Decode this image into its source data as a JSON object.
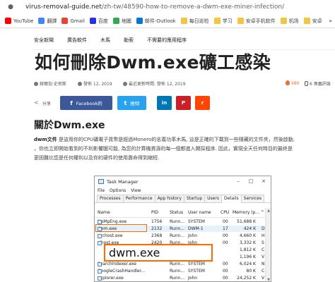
{
  "browser": {
    "url_host": "virus-removal-guide.net",
    "url_path": "/zh-tw/48590-how-to-remove-a-dwm-exe-miner-infection/",
    "bookmarks": [
      {
        "label": "YouTube",
        "icon": "youtube-icon"
      },
      {
        "label": "翻譯",
        "icon": "translate-icon"
      },
      {
        "label": "Gmail",
        "icon": "gmail-icon"
      },
      {
        "label": "百度",
        "icon": "baidu-icon"
      },
      {
        "label": "地圖",
        "icon": "maps-icon"
      },
      {
        "label": "邮件-Outlook",
        "icon": "outlook-icon"
      },
      {
        "label": "每日巡检",
        "icon": "folder-icon"
      },
      {
        "label": "学习",
        "icon": "folder-icon"
      },
      {
        "label": "安卓手机软件",
        "icon": "folder-icon"
      },
      {
        "label": "机场",
        "icon": "folder-icon"
      },
      {
        "label": "安卓",
        "icon": "folder-icon"
      }
    ],
    "bookmarks_more": "»"
  },
  "site_nav": [
    "安全新聞",
    "廣告軟件",
    "木馬",
    "勒索",
    "不需要的應用程序"
  ],
  "article": {
    "title": "如何刪除Dwm.exe礦工感染",
    "author": "赫爾加·史密斯",
    "published": "發佈 12, 2019",
    "updated": "最近更新時間: 發佈 12, 2019",
    "views": "980",
    "comments": "6 臭蟲評論",
    "share_label": "分享",
    "share_buttons": {
      "facebook": "Facebook的",
      "twitter": "推特",
      "linkedin": "in",
      "pinterest": "P",
      "reddit": "r"
    },
    "section_heading": "關於Dwm.exe",
    "paragraph_bold": "dwm文件",
    "paragraph_lines": [
      " 是盜用你的CPU礦電子貨幣是經過Monero的名義功率木馬, 這是正確的下載到一些隱藏的文件夾，然後啟動,",
      "，你也立即開始看到的不利影響圖可能, 為您的計算機資源的每一個都進入開採程序. 因此，實現全天任何時目的最終是",
      "更困難比您是任何權利以及你的硬件的使用壽命得到縮短."
    ]
  },
  "task_manager": {
    "title": "Task Manager",
    "window_controls": [
      "–",
      "□",
      "×"
    ],
    "menu": [
      "File",
      "Options",
      "View"
    ],
    "tabs": [
      "Processes",
      "Performance",
      "App history",
      "Startup",
      "Users",
      "Details",
      "Services"
    ],
    "active_tab": "Details",
    "columns": [
      "Name",
      "PID",
      "Status",
      "User name",
      "CPU",
      "Memory (p...",
      "^"
    ],
    "rows": [
      {
        "name": "MsMpEng.exe",
        "pid": "1756",
        "status": "Runn...",
        "user": "SYSTEM",
        "cpu": "00",
        "memory": "51,688 K",
        "extra": ""
      },
      {
        "name": "dwm.exe",
        "pid": "2132",
        "status": "Runn...",
        "user": "DWM-1",
        "cpu": "17",
        "memory": "424 K",
        "extra": "D"
      },
      {
        "name": "svchost.exe",
        "pid": "2368",
        "status": "Runn...",
        "user": "John",
        "cpu": "00",
        "memory": "4,660 K",
        "extra": "H"
      },
      {
        "name": "sihost.exe",
        "pid": "2420",
        "status": "Runn...",
        "user": "John",
        "cpu": "00",
        "memory": "3,332 K",
        "extra": "S"
      },
      {
        "name": "",
        "pid": "",
        "status": "",
        "user": "",
        "cpu": "",
        "memory": "1,812 K",
        "extra": "C"
      },
      {
        "name": "",
        "pid": "",
        "status": "",
        "user": "",
        "cpu": "",
        "memory": "1,196 K",
        "extra": "V"
      },
      {
        "name": "SearchIndexer.exe",
        "pid": "",
        "status": "Runn...",
        "user": "SYSTEM",
        "cpu": "00",
        "memory": "6,024 K",
        "extra": "N"
      },
      {
        "name": "GoogleCrashHandler...",
        "pid": "",
        "status": "Runn...",
        "user": "SYSTEM",
        "cpu": "00",
        "memory": "80 K",
        "extra": "C"
      },
      {
        "name": "explorer.exe",
        "pid": "",
        "status": "Runn...",
        "user": "John",
        "cpu": "00",
        "memory": "24,252 K",
        "extra": "V"
      }
    ],
    "callout_text": "dwm.exe",
    "highlight_color": "#ff6a00"
  }
}
